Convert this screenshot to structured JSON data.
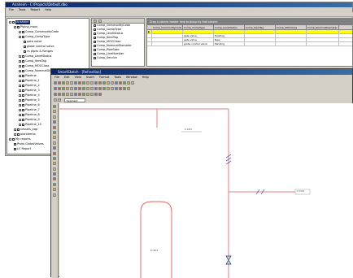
{
  "main_window": {
    "title": "Anaheim - C:\\Projects\\Default.dbo",
    "menu": [
      "File",
      "Tools",
      "Report",
      "Help"
    ]
  },
  "tree": {
    "root": "Anaheim",
    "items": [
      {
        "label": "Anaheim",
        "depth": 0,
        "expander": "-",
        "selected": true
      },
      {
        "label": "Piping_main",
        "depth": 1,
        "expander": "-",
        "selected": false
      },
      {
        "label": "Comp_CommodityCode",
        "depth": 2,
        "expander": "-",
        "selected": false
      },
      {
        "label": "Comp_CompType",
        "depth": 2,
        "expander": "-",
        "selected": false
      },
      {
        "label": "gate valve",
        "depth": 3,
        "expander": "",
        "selected": false
      },
      {
        "label": "globe control valve",
        "depth": 3,
        "expander": "",
        "selected": false
      },
      {
        "label": "cs pipes & flanges",
        "depth": 3,
        "expander": "",
        "selected": false
      },
      {
        "label": "Comp_LevelStatus",
        "depth": 2,
        "expander": "+",
        "selected": false
      },
      {
        "label": "Comp_ItemTag",
        "depth": 2,
        "expander": "+",
        "selected": false
      },
      {
        "label": "Comp_MOCClass",
        "depth": 2,
        "expander": "+",
        "selected": false
      },
      {
        "label": "Comp_NominalDiameter",
        "depth": 2,
        "expander": "+",
        "selected": false
      },
      {
        "label": "Pipeline",
        "depth": 2,
        "expander": "+",
        "selected": false
      },
      {
        "label": "Pipeline_1",
        "depth": 2,
        "expander": "+",
        "selected": false
      },
      {
        "label": "Pipeline_2",
        "depth": 2,
        "expander": "+",
        "selected": false
      },
      {
        "label": "Pipeline_3",
        "depth": 2,
        "expander": "+",
        "selected": false
      },
      {
        "label": "Pipeline_4",
        "depth": 2,
        "expander": "+",
        "selected": false
      },
      {
        "label": "Pipeline_5",
        "depth": 2,
        "expander": "+",
        "selected": false
      },
      {
        "label": "Pipeline_6",
        "depth": 2,
        "expander": "+",
        "selected": false
      },
      {
        "label": "Pipeline_7",
        "depth": 2,
        "expander": "+",
        "selected": false
      },
      {
        "label": "Pipeline_8",
        "depth": 2,
        "expander": "+",
        "selected": false
      },
      {
        "label": "Pipeline_9",
        "depth": 2,
        "expander": "+",
        "selected": false
      },
      {
        "label": "Pipeline_10",
        "depth": 2,
        "expander": "+",
        "selected": false
      },
      {
        "label": "vessels_eqp",
        "depth": 1,
        "expander": "+",
        "selected": false
      },
      {
        "label": "plantitems",
        "depth": 1,
        "expander": "+",
        "selected": false
      },
      {
        "label": "My reports",
        "depth": 0,
        "expander": "-",
        "selected": false
      },
      {
        "label": "Proto GlobalValves",
        "depth": 1,
        "expander": "",
        "selected": false
      },
      {
        "label": "LC Report",
        "depth": 1,
        "expander": "",
        "selected": false
      }
    ]
  },
  "field_list": {
    "items": [
      "Comp_CommodityCode",
      "Comp_CompType",
      "Comp_LevelStatus",
      "Comp_ItemTag",
      "Comp_MOCClass",
      "Comp_NominalDiameter",
      "Comp_PipeSpec",
      "Comp_LineNumber",
      "Comp_Service"
    ]
  },
  "grid": {
    "group_hint": "Drag a column header here to group by that column",
    "columns": [
      "Comp_CommodityCode",
      "Comp_CompType",
      "Comp_LevelStatus",
      "Comp_ItemTag",
      "Comp_MOCClass",
      "Comp_NominalDiameter"
    ],
    "rows": [
      [
        "",
        "",
        "",
        "",
        "",
        ""
      ],
      [
        "",
        "gate valve",
        "Existing",
        "",
        "",
        ""
      ],
      [
        "",
        "gate valve",
        "New",
        "",
        "",
        ""
      ],
      [
        "",
        "globe control valve",
        "Pending",
        "",
        "",
        ""
      ]
    ]
  },
  "sketch_window": {
    "title": "SmartSketch - [Refraction]",
    "menu": [
      "File",
      "Edit",
      "View",
      "Insert",
      "Format",
      "Tools",
      "Window",
      "Help"
    ],
    "combo_value": "Segment",
    "vessel_label": "D-404",
    "pipe_label_top": "P-1042",
    "pipe_label_right": "P-1043"
  },
  "colors": {
    "title_bar": "#0a246a",
    "chrome": "#d4d0c8",
    "pipe": "#e08080",
    "selection_row": "#ffff00",
    "vessel": "#e06060"
  }
}
